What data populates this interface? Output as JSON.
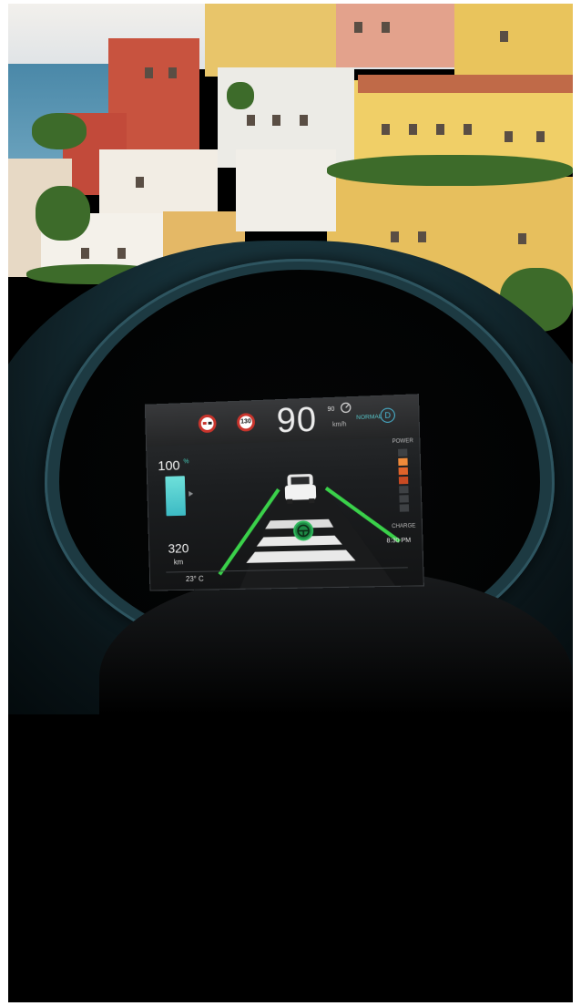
{
  "cluster": {
    "speed_limit_sign_1": "",
    "speed_limit_sign_2": "130",
    "current_speed": "90",
    "speed_unit": "km/h",
    "cruise_set_speed": "90",
    "drive_mode": "NORMAL",
    "gear": "D",
    "battery_percent": "100",
    "battery_percent_unit": "%",
    "range_value": "320",
    "range_unit": "km",
    "power_label": "POWER",
    "charge_label": "CHARGE",
    "clock": "8:30 PM",
    "outside_temp": "23° C"
  },
  "icons": {
    "no_overtaking": "no-overtaking-icon",
    "cruise_control": "adaptive-cruise-icon",
    "car": "car-icon",
    "lane_assist": "steering-wheel-icon"
  },
  "colors": {
    "battery_fill": "#3cbac4",
    "lane_lines": "#3ad14a",
    "power_active": "#e0632a",
    "accent": "#4ab8d6"
  }
}
